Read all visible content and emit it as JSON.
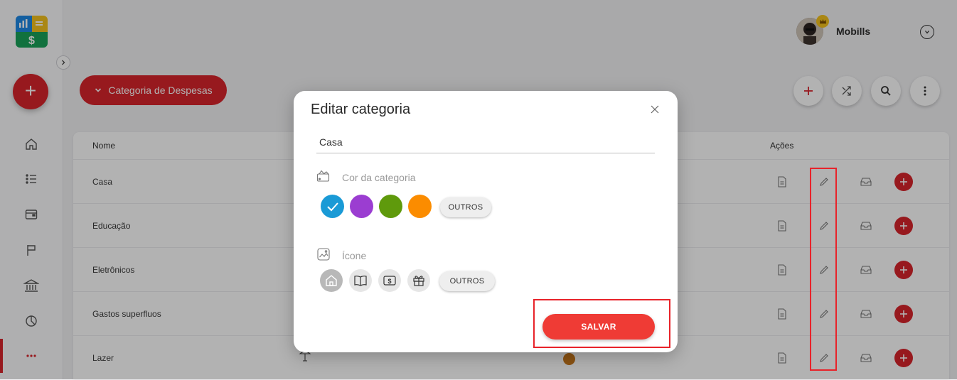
{
  "header": {
    "username": "Mobills"
  },
  "toolbar": {
    "category_type_label": "Categoria de Despesas"
  },
  "table": {
    "col_name": "Nome",
    "col_actions": "Ações",
    "rows": [
      {
        "name": "Casa"
      },
      {
        "name": "Educação"
      },
      {
        "name": "Eletrônicos"
      },
      {
        "name": "Gastos superfluos"
      },
      {
        "name": "Lazer",
        "color": "#c8781c"
      }
    ]
  },
  "modal": {
    "title": "Editar categoria",
    "name_value": "Casa",
    "color_label": "Cor da categoria",
    "colors": [
      "#1a9ad6",
      "#9b3dd1",
      "#5f9a0c",
      "#fb8c00"
    ],
    "selected_color": "#1a9ad6",
    "color_more_label": "OUTROS",
    "icon_label": "Ícone",
    "icons": [
      "home-icon",
      "book-icon",
      "money-icon",
      "gift-icon"
    ],
    "icon_more_label": "OUTROS",
    "save_label": "SALVAR"
  },
  "colors": {
    "accent": "#d9252c",
    "save": "#ef3b35",
    "highlight": "#e8232a"
  }
}
